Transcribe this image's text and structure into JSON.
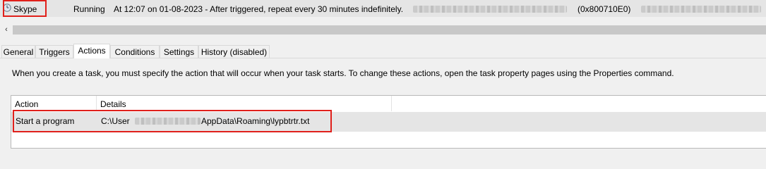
{
  "task_row": {
    "name": "Skype",
    "status": "Running",
    "trigger": "At 12:07 on 01-08-2023 - After triggered, repeat every 30 minutes indefinitely.",
    "result": "(0x800710E0)"
  },
  "scrollbar": {
    "left_arrow": "‹"
  },
  "tabs": [
    {
      "label": "General"
    },
    {
      "label": "Triggers"
    },
    {
      "label": "Actions"
    },
    {
      "label": "Conditions"
    },
    {
      "label": "Settings"
    },
    {
      "label": "History (disabled)"
    }
  ],
  "actions_panel": {
    "description": "When you create a task, you must specify the action that will occur when your task starts.  To change these actions, open the task property pages using the Properties command.",
    "columns": [
      "Action",
      "Details"
    ],
    "rows": [
      {
        "action": "Start a program",
        "details_prefix": "C:\\User",
        "details_suffix": "AppData\\Roaming\\lypbtrtr.txt"
      }
    ]
  },
  "colors": {
    "highlight": "#e0201b",
    "selected_row": "#e5e5e5"
  },
  "icons": {
    "task": "clock-icon",
    "scroll_left": "chevron-left-icon"
  }
}
